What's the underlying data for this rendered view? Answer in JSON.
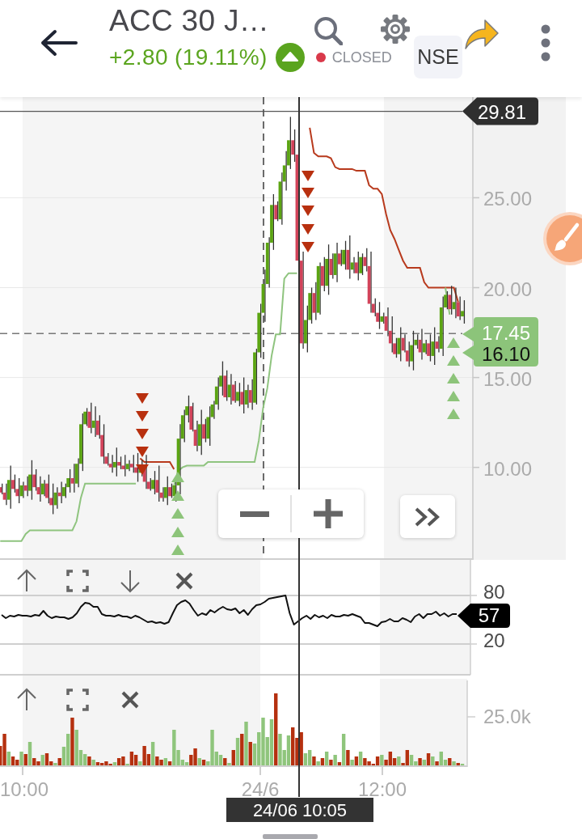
{
  "header": {
    "title": "ACC 30 J…",
    "change": "+2.80 (19.11%)",
    "rising": true,
    "market_open": false,
    "market_status": "CLOSED",
    "exchange": "NSE"
  },
  "price_panel": {
    "crosshair_price": "29.81",
    "price_tags": [
      "17.45",
      "16.10"
    ],
    "chart_data": {
      "type": "line",
      "grid": true,
      "ylim": [
        4.9,
        30.6
      ],
      "yticks": [
        {
          "value": 25,
          "label": "25.00"
        },
        {
          "value": 20,
          "label": "20.00"
        },
        {
          "value": 15,
          "label": "15.00"
        },
        {
          "value": 10,
          "label": "10.00"
        }
      ],
      "ref_lines": [
        {
          "axis": "y",
          "value": 17.45
        },
        {
          "axis": "y",
          "value": 29.81
        }
      ],
      "series": [
        {
          "color": "#b83a1d",
          "values": [
            null,
            null,
            null,
            null,
            null,
            null,
            null,
            null,
            null,
            null,
            null,
            null,
            null,
            null,
            null,
            null,
            null,
            null,
            null,
            null,
            null,
            null,
            null,
            null,
            null,
            null,
            null,
            null,
            null,
            null,
            null,
            null,
            null,
            10.5,
            10.3,
            10.3,
            10.3,
            10.3,
            10.3,
            10.3,
            10.3,
            9.9,
            null,
            null,
            null,
            null,
            null,
            null,
            null,
            null,
            null,
            null,
            null,
            null,
            null,
            null,
            null,
            null,
            null,
            null,
            null,
            null,
            null,
            null,
            null,
            null,
            null,
            null,
            null,
            null,
            null,
            null,
            null,
            28.9,
            27.5,
            27.3,
            27.3,
            27.3,
            27.2,
            26.7,
            26.6,
            26.6,
            26.6,
            26.6,
            26.5,
            26.5,
            26.5,
            25.7,
            25.5,
            25.5,
            25.2,
            24.1,
            23.2,
            22.7,
            22.1,
            21.5,
            21.1,
            21.1,
            21.1,
            21.1,
            20.3,
            20.0,
            20.0,
            20.0,
            20.0,
            20.0,
            20.0,
            20.0,
            19.2,
            null,
            null,
            null
          ]
        },
        {
          "color": "#8fc47f",
          "values": [
            5.9,
            5.9,
            5.9,
            5.9,
            5.9,
            5.9,
            6.3,
            6.5,
            6.5,
            6.5,
            6.5,
            6.5,
            6.5,
            6.5,
            6.5,
            6.5,
            6.5,
            6.5,
            7.0,
            8.3,
            9.1,
            9.1,
            9.1,
            9.1,
            9.1,
            9.1,
            9.1,
            9.1,
            9.1,
            9.1,
            9.1,
            9.1,
            9.1,
            null,
            null,
            null,
            null,
            null,
            null,
            null,
            null,
            9.0,
            9.8,
            10.0,
            10.1,
            10.1,
            10.1,
            10.1,
            10.1,
            10.3,
            10.3,
            10.3,
            10.3,
            10.3,
            10.3,
            10.3,
            10.3,
            10.3,
            10.3,
            10.3,
            10.3,
            11.5,
            13.3,
            14.4,
            16.2,
            17.4,
            17.4,
            20.5,
            20.8,
            20.8,
            20.8,
            null,
            null,
            null,
            null,
            null,
            null,
            null,
            null,
            null,
            null,
            null,
            null,
            null,
            null,
            null,
            null,
            null,
            null,
            null,
            null,
            null,
            null,
            null,
            null,
            null,
            null,
            null,
            null,
            null,
            null,
            null,
            null,
            null,
            null,
            20.0,
            18.5,
            null,
            null,
            null
          ]
        }
      ]
    }
  },
  "rsi_panel": {
    "current_value": "57",
    "chart_data": {
      "type": "line",
      "grid": true,
      "ylim": [
        -18,
        124
      ],
      "yticks": [
        {
          "value": 80,
          "label": "80"
        },
        {
          "value": 20,
          "label": "20"
        }
      ],
      "series": [
        {
          "color": "#111111",
          "values": [
            56,
            52,
            55,
            54,
            56,
            55,
            55,
            54,
            56,
            55,
            61,
            55,
            52,
            54,
            53,
            53,
            51,
            53,
            58,
            66,
            71,
            70,
            66,
            66,
            57,
            55,
            55,
            54,
            56,
            54,
            54,
            52,
            55,
            53,
            50,
            47,
            48,
            46,
            47,
            45,
            47,
            58,
            68,
            72,
            74,
            70,
            62,
            55,
            58,
            56,
            62,
            59,
            63,
            66,
            63,
            62,
            64,
            58,
            62,
            56,
            63,
            68,
            69,
            72,
            76,
            77,
            78,
            79,
            80,
            58,
            44,
            48,
            52,
            55,
            51,
            56,
            53,
            55,
            52,
            56,
            54,
            54,
            56,
            55,
            57,
            55,
            53,
            46,
            46,
            44,
            42,
            47,
            48,
            51,
            48,
            48,
            52,
            50,
            47,
            54,
            57,
            52,
            57,
            57,
            60,
            55,
            58,
            54,
            57,
            57
          ]
        }
      ]
    }
  },
  "volume_panel": {
    "axis_labels": [
      "25.0k"
    ]
  },
  "x_axis": {
    "labels": [
      "10:00",
      "24/6",
      "12:00"
    ],
    "crosshair_time": "24/06 10:05"
  }
}
